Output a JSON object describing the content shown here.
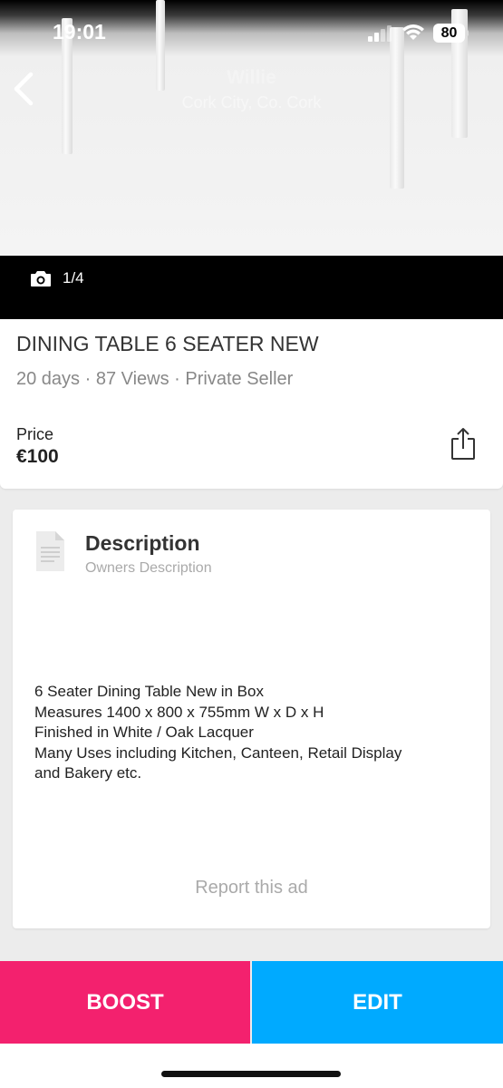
{
  "status_bar": {
    "time": "19:01",
    "battery": "80"
  },
  "header": {
    "seller_name": "Willie",
    "seller_location": "Cork City, Co. Cork",
    "back_icon": "chevron-left-icon"
  },
  "gallery": {
    "photo_count": "1/4",
    "camera_icon": "camera-icon"
  },
  "listing": {
    "title": "DINING TABLE 6 SEATER NEW",
    "meta": "20 days · 87 Views · Private Seller",
    "price_label": "Price",
    "price": "€100",
    "share_icon": "share-icon"
  },
  "description": {
    "heading": "Description",
    "subheading": "Owners Description",
    "lines": [
      "6 Seater Dining Table New in Box",
      "Measures 1400 x 800 x 755mm W x D x H",
      "Finished in White / Oak Lacquer",
      "Many Uses including Kitchen, Canteen, Retail Display",
      "and Bakery etc."
    ],
    "report_link": "Report this ad"
  },
  "actions": {
    "boost_label": "BOOST",
    "edit_label": "EDIT"
  },
  "colors": {
    "boost": "#f3216e",
    "edit": "#00aaff"
  }
}
